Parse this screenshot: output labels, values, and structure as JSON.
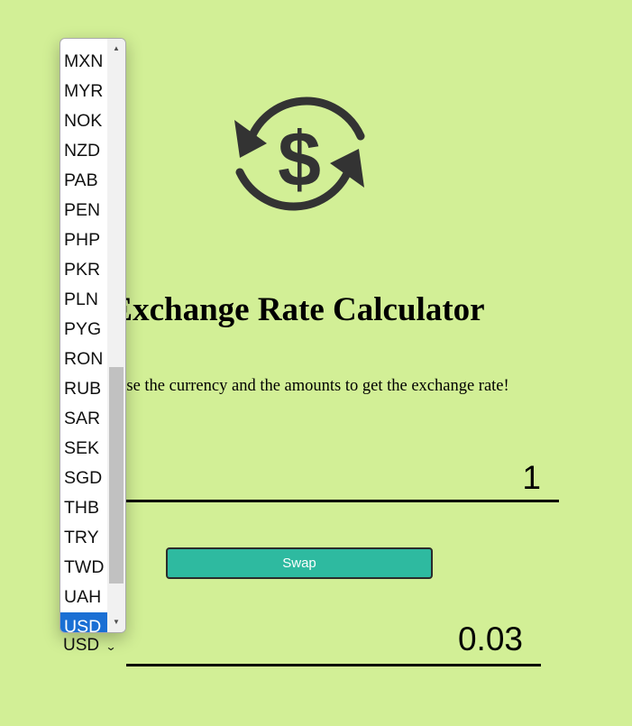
{
  "logo": {
    "icon": "currency-exchange-icon",
    "color": "#333333"
  },
  "header": {
    "title": "Exchange Rate Calculator",
    "subtitle": "Choose the currency and the amounts to get the exchange rate!"
  },
  "converter": {
    "amount_one": "1",
    "amount_two": "0.03",
    "swap_label": "Swap",
    "currency_two": "USD"
  },
  "dropdown": {
    "options": [
      "MXN",
      "MYR",
      "NOK",
      "NZD",
      "PAB",
      "PEN",
      "PHP",
      "PKR",
      "PLN",
      "PYG",
      "RON",
      "RUB",
      "SAR",
      "SEK",
      "SGD",
      "THB",
      "TRY",
      "TWD",
      "UAH",
      "USD"
    ],
    "selected": "USD"
  },
  "colors": {
    "background": "#d2ef96",
    "accent": "#2ebaa0",
    "selected_option": "#1a6fd4"
  }
}
